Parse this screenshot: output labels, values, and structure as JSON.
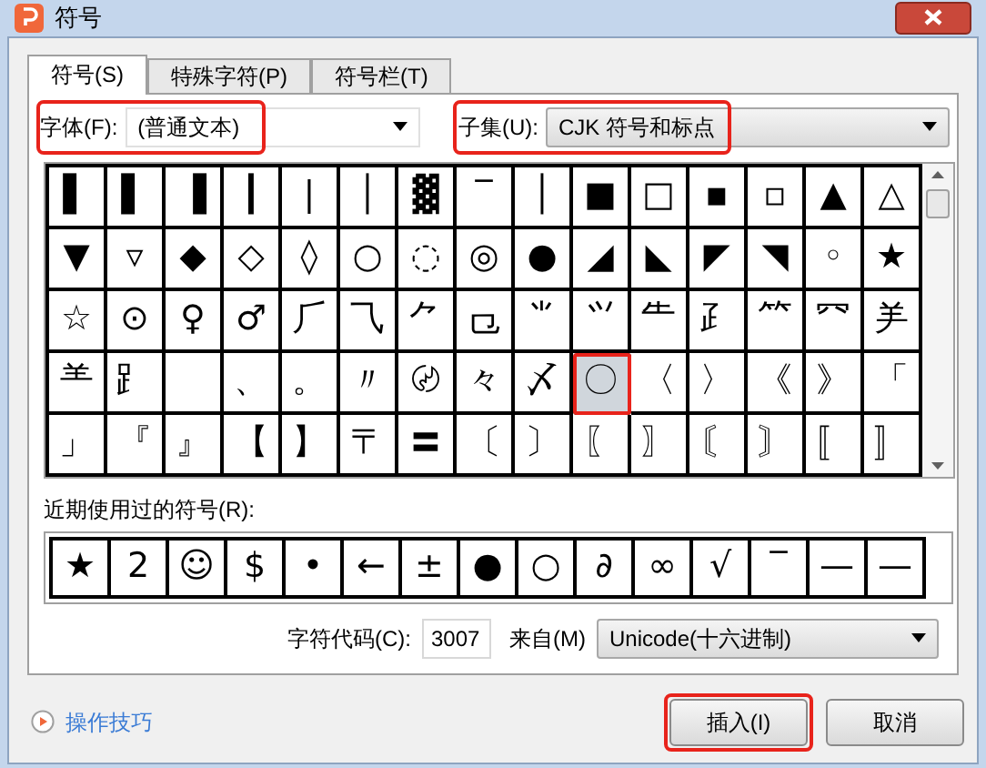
{
  "window": {
    "title": "符号"
  },
  "tabs": [
    {
      "label": "符号(S)",
      "selected": true
    },
    {
      "label": "特殊字符(P)",
      "selected": false
    },
    {
      "label": "符号栏(T)",
      "selected": false
    }
  ],
  "font": {
    "label": "字体(F):",
    "value": "(普通文本)",
    "highlighted": true
  },
  "subset": {
    "label": "子集(U):",
    "value": "CJK 符号和标点",
    "highlighted": true
  },
  "symbol_grid": {
    "rows": [
      [
        {
          "char": "▌",
          "selected": false
        },
        {
          "char": "▌",
          "selected": false
        },
        {
          "char": "▐",
          "selected": false
        },
        {
          "char": "┃",
          "selected": false
        },
        {
          "char": "|",
          "selected": false
        },
        {
          "char": "│",
          "selected": false
        },
        {
          "char": "▓",
          "selected": false
        },
        {
          "char": "‾",
          "selected": false
        },
        {
          "char": "│",
          "selected": false
        },
        {
          "char": "■",
          "selected": false
        },
        {
          "char": "□",
          "selected": false
        },
        {
          "char": "▪",
          "selected": false
        },
        {
          "char": "▫",
          "selected": false
        },
        {
          "char": "▲",
          "selected": false
        },
        {
          "char": "△",
          "selected": false
        }
      ],
      [
        {
          "char": "▼",
          "selected": false
        },
        {
          "char": "▿",
          "selected": false
        },
        {
          "char": "◆",
          "selected": false
        },
        {
          "char": "◇",
          "selected": false
        },
        {
          "char": "◊",
          "selected": false
        },
        {
          "char": "○",
          "selected": false
        },
        {
          "char": "◌",
          "selected": false
        },
        {
          "char": "◎",
          "selected": false
        },
        {
          "char": "●",
          "selected": false
        },
        {
          "char": "◢",
          "selected": false
        },
        {
          "char": "◣",
          "selected": false
        },
        {
          "char": "◤",
          "selected": false
        },
        {
          "char": "◥",
          "selected": false
        },
        {
          "char": "◦",
          "selected": false
        },
        {
          "char": "★",
          "selected": false
        }
      ],
      [
        {
          "char": "☆",
          "selected": false
        },
        {
          "char": "⊙",
          "selected": false
        },
        {
          "char": "♀",
          "selected": false
        },
        {
          "char": "♂",
          "selected": false
        },
        {
          "char": "⺁",
          "selected": false
        },
        {
          "char": "⺄",
          "selected": false
        },
        {
          "char": "⺈",
          "selected": false
        },
        {
          "char": "⺋",
          "selected": false
        },
        {
          "char": "⺌",
          "selected": false
        },
        {
          "char": "⺍",
          "selected": false
        },
        {
          "char": "⺧",
          "selected": false
        },
        {
          "char": "⺪",
          "selected": false
        },
        {
          "char": "⺮",
          "selected": false
        },
        {
          "char": "⺳",
          "selected": false
        },
        {
          "char": "⺶",
          "selected": false
        }
      ],
      [
        {
          "char": "⺷",
          "selected": false
        },
        {
          "char": "⻊",
          "selected": false
        },
        {
          "selected": false
        },
        {
          "char": "、",
          "selected": false
        },
        {
          "char": "。",
          "selected": false
        },
        {
          "char": "〃",
          "selected": false
        },
        {
          "char": "〄",
          "selected": false
        },
        {
          "char": "々",
          "selected": false
        },
        {
          "char": "〆",
          "selected": false
        },
        {
          "char": "〇",
          "selected": true
        },
        {
          "char": "〈",
          "selected": false
        },
        {
          "char": "〉",
          "selected": false
        },
        {
          "char": "《",
          "selected": false
        },
        {
          "char": "》",
          "selected": false
        },
        {
          "char": "「",
          "selected": false
        }
      ],
      [
        {
          "char": "」",
          "selected": false
        },
        {
          "char": "『",
          "selected": false
        },
        {
          "char": "』",
          "selected": false
        },
        {
          "char": "【",
          "selected": false
        },
        {
          "char": "】",
          "selected": false
        },
        {
          "char": "〒",
          "selected": false
        },
        {
          "char": "〓",
          "selected": false
        },
        {
          "char": "〔",
          "selected": false
        },
        {
          "char": "〕",
          "selected": false
        },
        {
          "char": "〖",
          "selected": false
        },
        {
          "char": "〗",
          "selected": false
        },
        {
          "char": "〘",
          "selected": false
        },
        {
          "char": "〙",
          "selected": false
        },
        {
          "char": "〚",
          "selected": false
        },
        {
          "char": "〛",
          "selected": false
        }
      ]
    ]
  },
  "recent": {
    "label": "近期使用过的符号(R):",
    "symbols": [
      "★",
      "2",
      "☺",
      "$",
      "•",
      "←",
      "±",
      "●",
      "○",
      "∂",
      "∞",
      "√",
      "‾",
      "—",
      "—"
    ]
  },
  "char_code": {
    "label": "字符代码(C):",
    "value": "3007"
  },
  "source": {
    "label": "来自(M)",
    "value": "Unicode(十六进制)"
  },
  "tips_link": "操作技巧",
  "buttons": [
    {
      "label": "插入(I)",
      "highlighted": true
    },
    {
      "label": "取消",
      "highlighted": false
    }
  ]
}
